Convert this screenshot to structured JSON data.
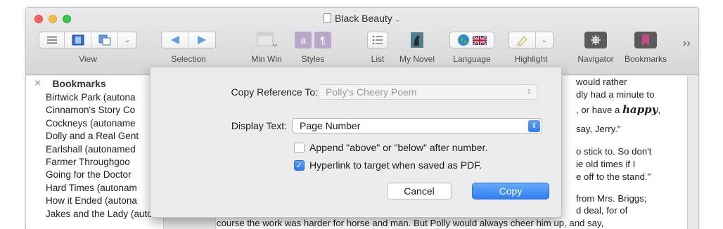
{
  "window": {
    "title": "Black Beauty"
  },
  "toolbar": {
    "view_label": "View",
    "selection_label": "Selection",
    "minwin_label": "Min Win",
    "styles_label": "Styles",
    "list_label": "List",
    "mynovel_label": "My Novel",
    "language_label": "Language",
    "highlight_label": "Highlight",
    "navigator_label": "Navigator",
    "bookmarks_label": "Bookmarks",
    "overflow_glyph": "››"
  },
  "sidebar": {
    "title": "Bookmarks",
    "close_glyph": "×",
    "items": [
      "Birtwick Park (autona",
      "Cinnamon's Story Co",
      "Cockneys (autoname",
      "Dolly and a Real Gent",
      "Earlshall (autonamed",
      "Farmer Throughgoo",
      "Going for the Doctor",
      "Hard Times (autonam",
      "How it Ended (autona",
      "Jakes and the Lady (auto"
    ]
  },
  "document": {
    "lines": [
      "would rather",
      "dly had a minute to",
      ", or have a",
      "happy",
      ",",
      " say, Jerry.\"",
      "o stick to. So don't",
      "ie old times if I",
      "e off to the stand.\"",
      "from Mrs. Briggs;",
      "d deal, for of",
      "course the work was harder for horse and man. But Polly would always cheer him up, and say,"
    ]
  },
  "dialog": {
    "copy_ref_label": "Copy Reference To:",
    "copy_ref_value": "Polly's Cheery Poem",
    "display_text_label": "Display Text:",
    "display_text_value": "Page Number",
    "append_label": "Append \"above\" or \"below\" after number.",
    "append_checked": false,
    "hyperlink_label": "Hyperlink to target when saved as PDF.",
    "hyperlink_checked": true,
    "cancel_label": "Cancel",
    "copy_label": "Copy",
    "accent_color": "#2f7cf2"
  }
}
